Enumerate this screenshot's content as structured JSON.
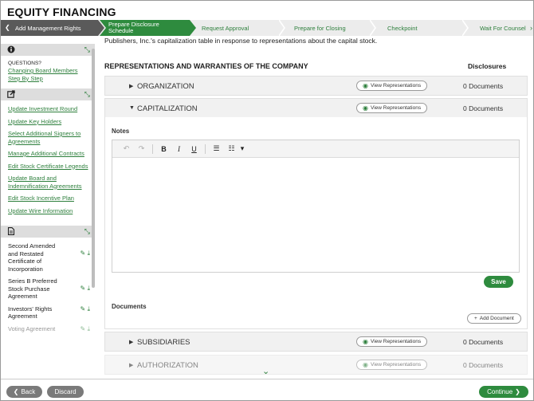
{
  "app": {
    "title": "EQUITY FINANCING"
  },
  "steps": {
    "lead_icon": "❮",
    "completed": "Add Management Rights",
    "active_line1": "Prepare Disclosure",
    "active_line2": "Schedule",
    "todo": [
      "Request Approval",
      "Prepare for Closing",
      "Checkpoint",
      "Wait For Counsel"
    ],
    "next_icon": "›"
  },
  "sidebar": {
    "info_panel": {
      "icon": "i",
      "collapse_icon": "⤡",
      "questions_label": "QUESTIONS?",
      "links": [
        "Changing Board Members",
        "Step By Step"
      ]
    },
    "actions_panel": {
      "icon": "↗",
      "collapse_icon": "⤡",
      "links": [
        "Update Investment Round",
        "Update Key Holders",
        "Select Additional Signers to Agreements",
        "Manage Additional Contracts",
        "Edit Stock Certificate Legends",
        "Update Board and Indemnification Agreements",
        "Edit Stock Incentive Plan",
        "Update Wire Information"
      ]
    },
    "docs_panel": {
      "icon": "▤",
      "collapse_icon": "⤡",
      "docs": [
        "Second Amended and Restated Certificate of Incorporation",
        "Series B Preferred Stock Purchase Agreement",
        "Investors' Rights Agreement",
        "Voting Agreement"
      ],
      "edit_icon": "✎",
      "download_icon": "⤓"
    }
  },
  "main": {
    "intro": "Publishers, Inc.'s capitalization table in response to representations about the capital stock.",
    "section_title": "REPRESENTATIONS AND WARRANTIES OF THE COMPANY",
    "disclosures_header": "Disclosures",
    "view_reps_label": "View Representations",
    "eye_icon": "◉",
    "items": [
      {
        "title": "ORGANIZATION",
        "count": "0 Documents",
        "caret": "▶"
      },
      {
        "title": "CAPITALIZATION",
        "count": "0 Documents",
        "caret": "▼"
      },
      {
        "title": "SUBSIDIARIES",
        "count": "0 Documents",
        "caret": "▶"
      },
      {
        "title": "AUTHORIZATION",
        "count": "0 Documents",
        "caret": "▶"
      }
    ],
    "notes_label": "Notes",
    "toolbar": {
      "undo": "↶",
      "redo": "↷",
      "bold": "B",
      "italic": "I",
      "underline": "U",
      "bullet_list": "☰",
      "numbered_list": "☷",
      "dropdown": "▾"
    },
    "save_label": "Save",
    "documents_label": "Documents",
    "add_document_label": "Add Document",
    "add_icon": "+",
    "scroll_more_icon": "⌄"
  },
  "footer": {
    "back_label": "Back",
    "back_icon": "❮",
    "discard_label": "Discard",
    "continue_label": "Continue",
    "continue_icon": "❯"
  },
  "colors": {
    "brand_green": "#2e8b3e",
    "gray_button": "#7a7a7a",
    "completed_step": "#5a5a5a"
  }
}
